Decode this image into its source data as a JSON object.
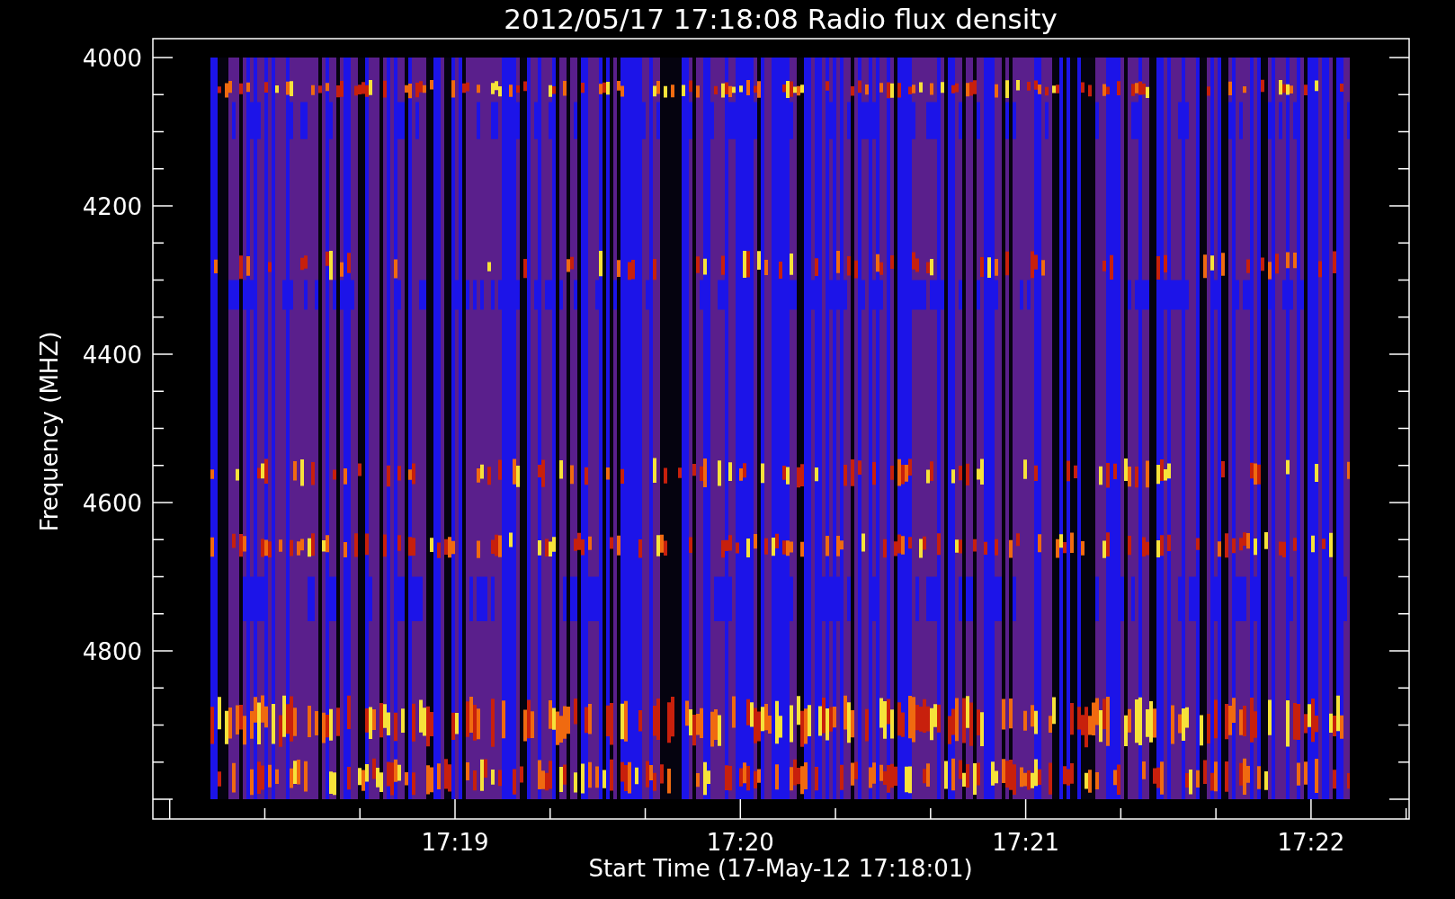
{
  "title": "2012/05/17 17:18:08 Radio flux density",
  "axes": {
    "ylabel": "Frequency (MHZ)",
    "xlabel": "Start Time (17-May-12 17:18:01)",
    "yticks": [
      "4000",
      "4200",
      "4400",
      "4600",
      "4800"
    ],
    "xticks": [
      "17:19",
      "17:20",
      "17:21",
      "17:22"
    ]
  }
}
